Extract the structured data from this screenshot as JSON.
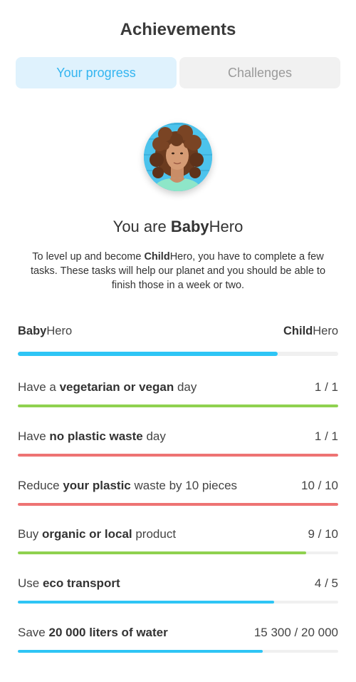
{
  "header": {
    "title": "Achievements"
  },
  "tabs": [
    {
      "label": "Your progress",
      "active": true
    },
    {
      "label": "Challenges",
      "active": false
    }
  ],
  "profile": {
    "heading_prefix": "You are ",
    "heading_bold": "Baby",
    "heading_suffix": "Hero",
    "description": {
      "part1": "To level up and become ",
      "bold": "Child",
      "part2": "Hero, you have to complete a few tasks. These tasks will help our planet and you should be able to finish those in a week or two."
    }
  },
  "levels": {
    "current_bold": "Baby",
    "current_rest": "Hero",
    "next_bold": "Child",
    "next_rest": "Hero",
    "progress": 0.81,
    "color": "#2ec5f5"
  },
  "tasks": [
    {
      "pre": "Have a ",
      "bold": "vegetarian or vegan",
      "post": " day",
      "value": "1 / 1",
      "progress": 1.0,
      "color": "#8fd14f"
    },
    {
      "pre": "Have ",
      "bold": "no plastic waste",
      "post": " day",
      "value": "1 / 1",
      "progress": 1.0,
      "color": "#ee7373"
    },
    {
      "pre": "Reduce ",
      "bold": "your plastic",
      "post": " waste by 10 pieces",
      "value": "10 / 10",
      "progress": 1.0,
      "color": "#ee7373"
    },
    {
      "pre": "Buy ",
      "bold": "organic or local",
      "post": " product",
      "value": "9 / 10",
      "progress": 0.9,
      "color": "#8fd14f"
    },
    {
      "pre": "Use ",
      "bold": "eco transport",
      "post": "",
      "value": "4 / 5",
      "progress": 0.8,
      "color": "#2ec5f5"
    },
    {
      "pre": "Save ",
      "bold": "20 000 liters of water",
      "post": "",
      "value": "15 300 / 20 000",
      "progress": 0.765,
      "color": "#2ec5f5"
    }
  ]
}
